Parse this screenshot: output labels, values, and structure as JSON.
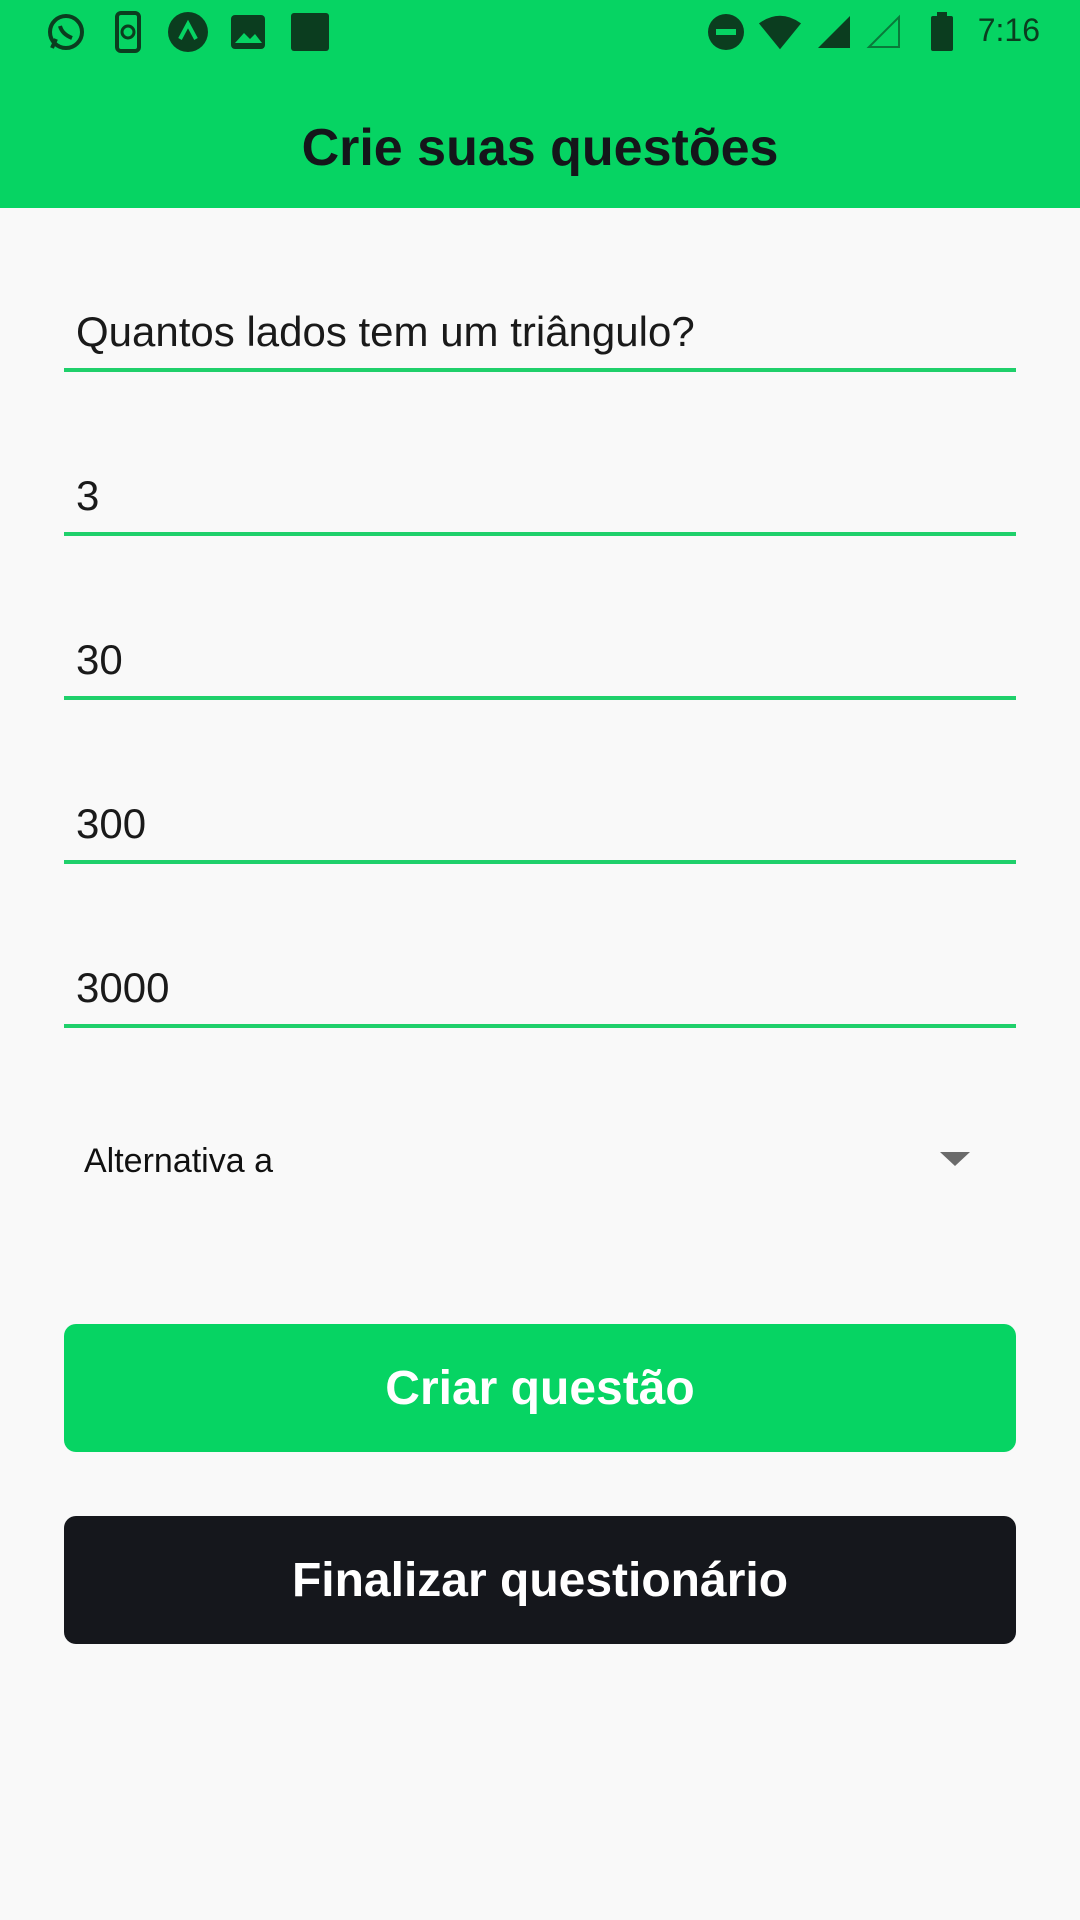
{
  "status_bar": {
    "time": "7:16",
    "left_icons": [
      "whatsapp-icon",
      "phone-sync-icon",
      "arrow-app-icon",
      "gallery-icon",
      "square-app-icon"
    ],
    "right_icons": [
      "do-not-disturb-icon",
      "wifi-icon",
      "signal-icon",
      "signal-empty-icon",
      "battery-icon"
    ]
  },
  "header": {
    "title": "Crie suas questões"
  },
  "form": {
    "question": "Quantos lados tem um triângulo?",
    "option_1": "3",
    "option_2": "30",
    "option_3": "300",
    "option_4": "3000",
    "correct_select": {
      "selected": "Alternativa a"
    }
  },
  "buttons": {
    "create": "Criar questão",
    "finish": "Finalizar questionário"
  },
  "colors": {
    "accent": "#06d463",
    "underline": "#1fd06b",
    "dark_button": "#15171c",
    "background": "#f9f9f9"
  }
}
